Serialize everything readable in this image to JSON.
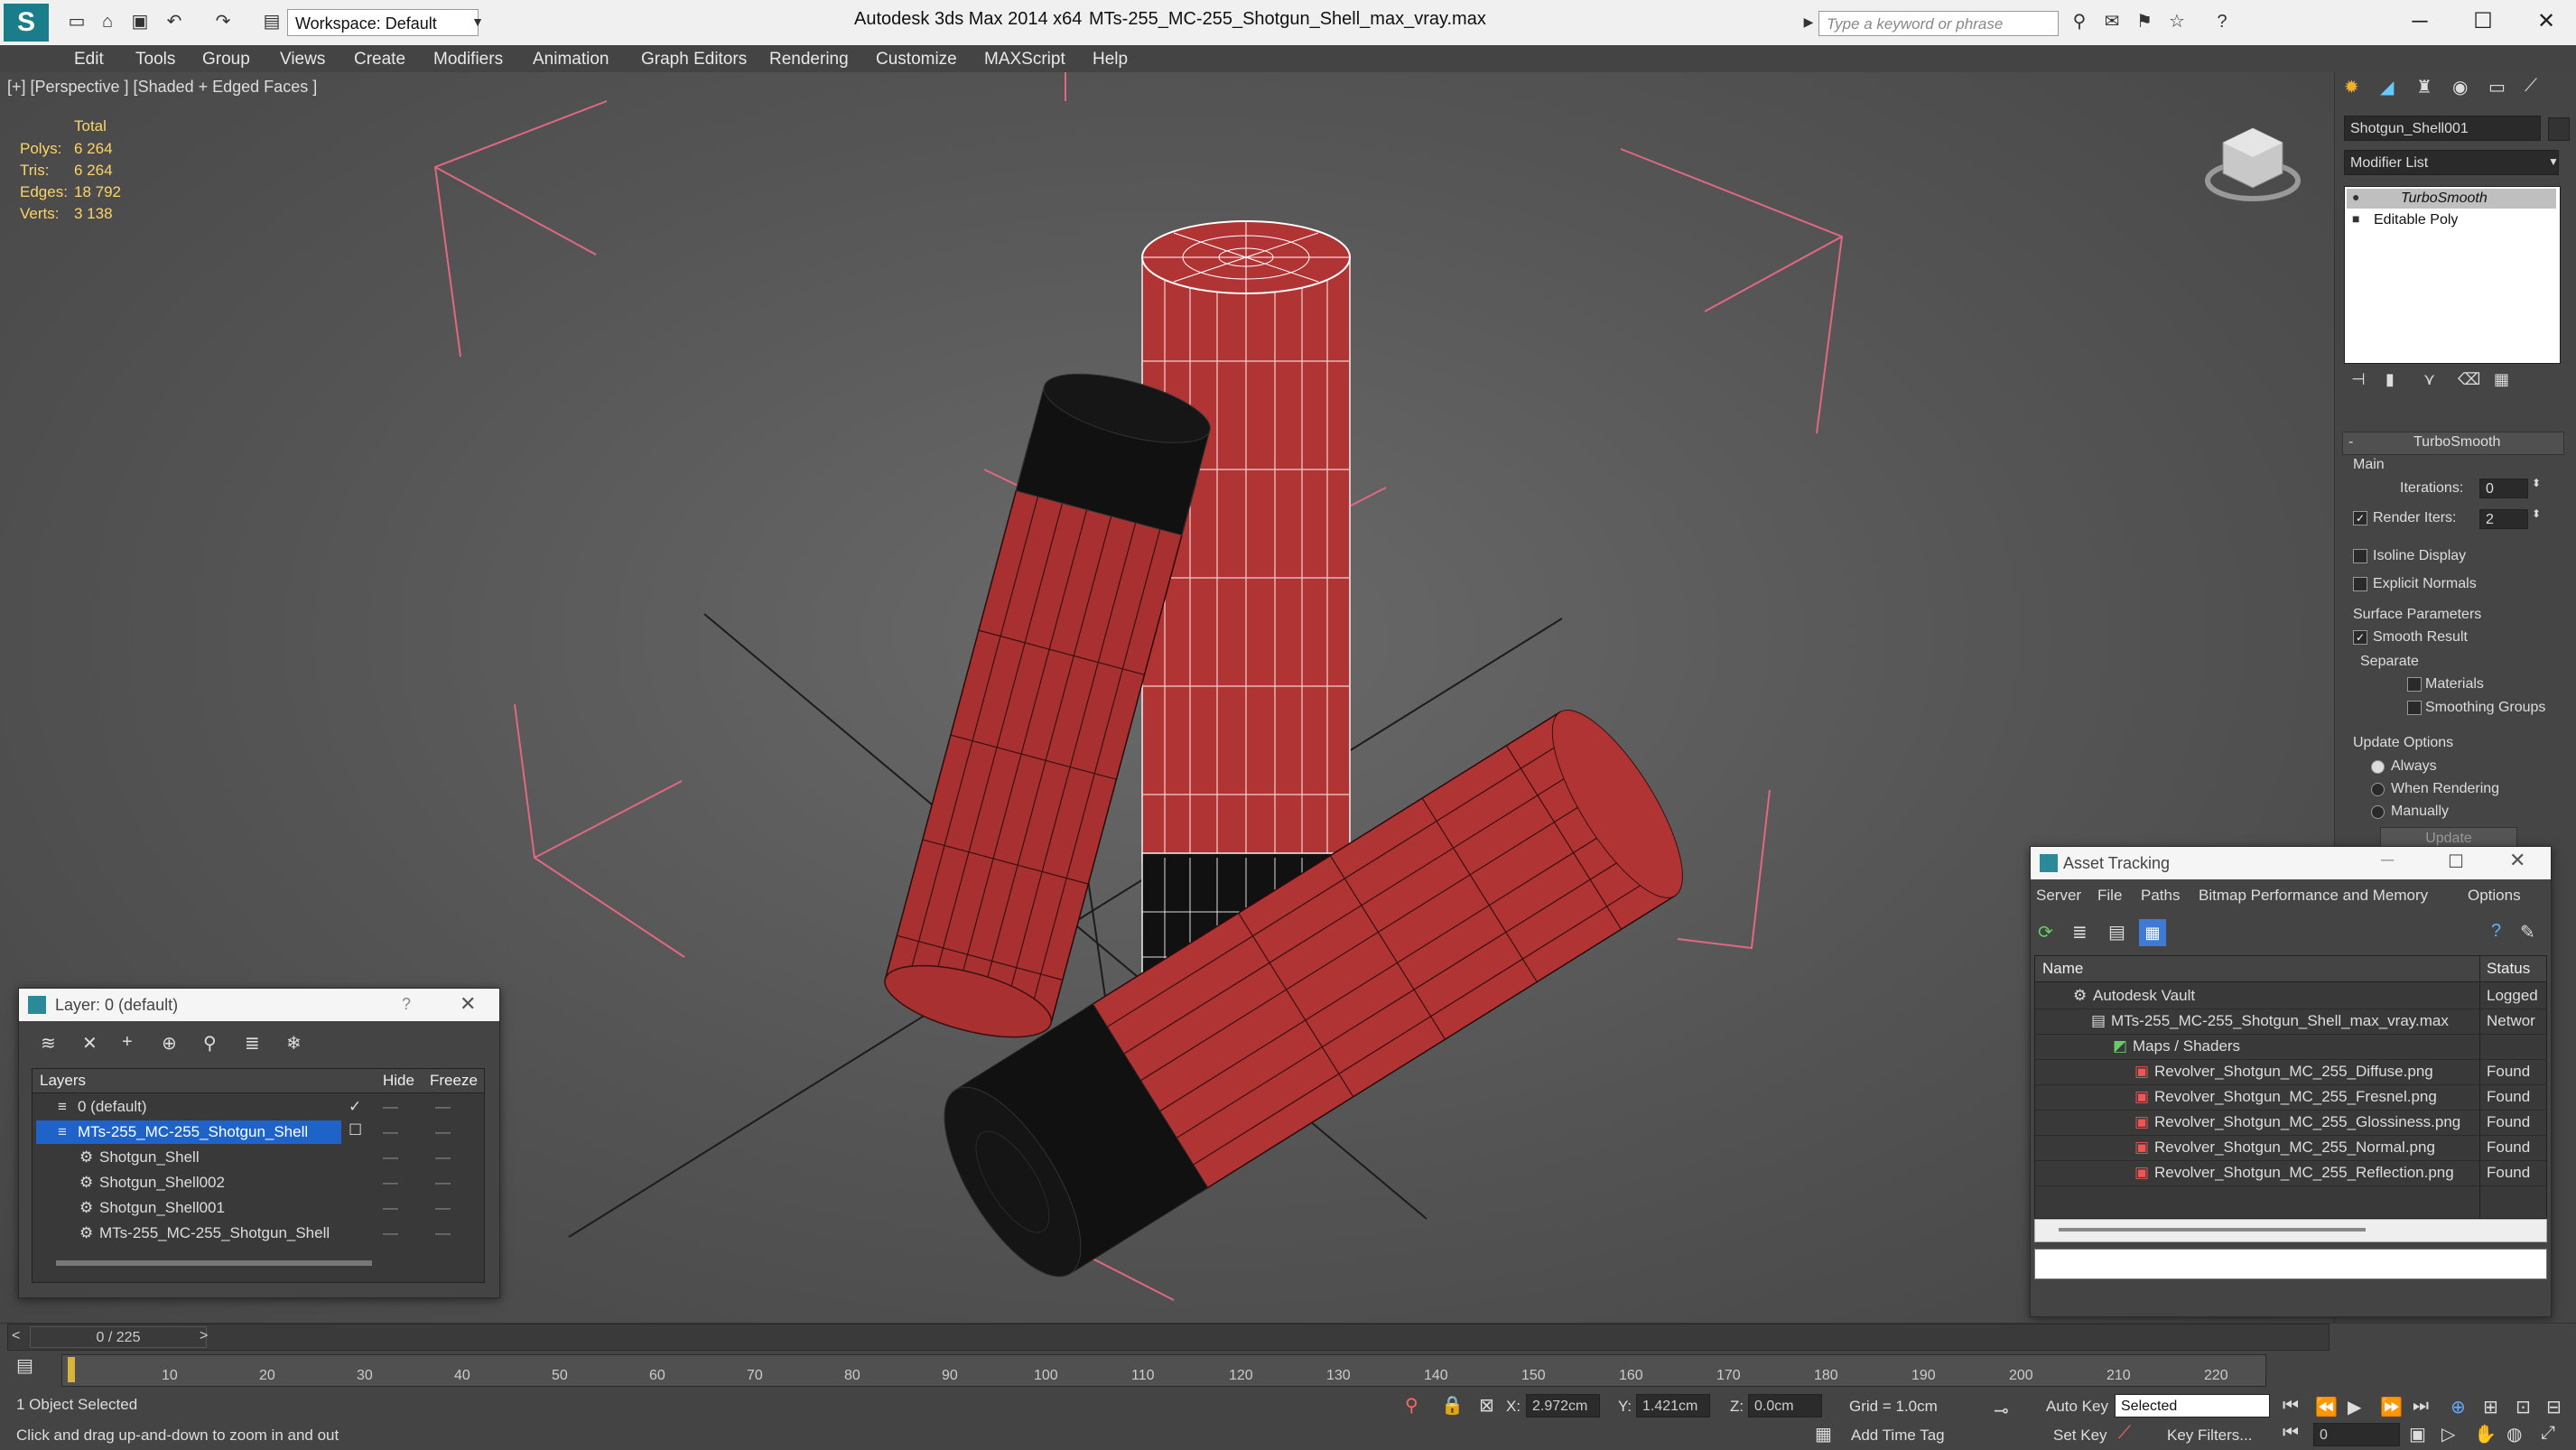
{
  "app": {
    "title": "Autodesk 3ds Max  2014 x64",
    "file": "MTs-255_MC-255_Shotgun_Shell_max_vray.max",
    "workspace": "Workspace: Default",
    "search_placeholder": "Type a keyword or phrase"
  },
  "menu": [
    "Edit",
    "Tools",
    "Group",
    "Views",
    "Create",
    "Modifiers",
    "Animation",
    "Graph Editors",
    "Rendering",
    "Customize",
    "MAXScript",
    "Help"
  ],
  "viewport": {
    "label": "[+] [Perspective ] [Shaded + Edged Faces ]",
    "stats": {
      "header": "Total",
      "rows": [
        {
          "label": "Polys:",
          "value": "6 264"
        },
        {
          "label": "Tris:",
          "value": "6 264"
        },
        {
          "label": "Edges:",
          "value": "18 792"
        },
        {
          "label": "Verts:",
          "value": "3 138"
        }
      ]
    }
  },
  "command_panel": {
    "object_name": "Shotgun_Shell001",
    "modifier_list": "Modifier List",
    "stack": [
      "TurboSmooth",
      "Editable Poly"
    ],
    "rollout_title": "TurboSmooth",
    "main_label": "Main",
    "iterations_label": "Iterations:",
    "iterations_value": "0",
    "render_iters_label": "Render Iters:",
    "render_iters_value": "2",
    "isoline": "Isoline Display",
    "explicit_normals": "Explicit Normals",
    "surface_params": "Surface Parameters",
    "smooth_result": "Smooth Result",
    "separate": "Separate",
    "materials": "Materials",
    "smoothing_groups": "Smoothing Groups",
    "update_options": "Update Options",
    "always": "Always",
    "when_rendering": "When Rendering",
    "manually": "Manually",
    "update": "Update"
  },
  "layer_window": {
    "title": "Layer: 0 (default)",
    "help": "?",
    "col_layers": "Layers",
    "col_hide": "Hide",
    "col_freeze": "Freeze",
    "rows": [
      "0 (default)",
      "MTs-255_MC-255_Shotgun_Shell",
      "Shotgun_Shell",
      "Shotgun_Shell002",
      "Shotgun_Shell001",
      "MTs-255_MC-255_Shotgun_Shell"
    ]
  },
  "asset_window": {
    "title": "Asset Tracking",
    "menu": [
      "Server",
      "File",
      "Paths",
      "Bitmap Performance and Memory",
      "Options"
    ],
    "col_name": "Name",
    "col_status": "Status",
    "rows": [
      {
        "name": "Autodesk Vault",
        "status": "Logged"
      },
      {
        "name": "MTs-255_MC-255_Shotgun_Shell_max_vray.max",
        "status": "Networ"
      },
      {
        "name": "Maps / Shaders",
        "status": ""
      },
      {
        "name": "Revolver_Shotgun_MC_255_Diffuse.png",
        "status": "Found"
      },
      {
        "name": "Revolver_Shotgun_MC_255_Fresnel.png",
        "status": "Found"
      },
      {
        "name": "Revolver_Shotgun_MC_255_Glossiness.png",
        "status": "Found"
      },
      {
        "name": "Revolver_Shotgun_MC_255_Normal.png",
        "status": "Found"
      },
      {
        "name": "Revolver_Shotgun_MC_255_Reflection.png",
        "status": "Found"
      }
    ]
  },
  "timeline": {
    "frame": "0 / 225",
    "ticks": [
      "10",
      "20",
      "30",
      "40",
      "50",
      "60",
      "70",
      "80",
      "90",
      "100",
      "110",
      "120",
      "130",
      "140",
      "150",
      "160",
      "170",
      "180",
      "190",
      "200",
      "210",
      "220"
    ]
  },
  "status": {
    "selected": "1 Object Selected",
    "hint": "Click and drag up-and-down to zoom in and out",
    "x_label": "X:",
    "x": "2.972cm",
    "y_label": "Y:",
    "y": "1.421cm",
    "z_label": "Z:",
    "z": "0.0cm",
    "grid": "Grid = 1.0cm",
    "add_time_tag": "Add Time Tag",
    "auto_key": "Auto Key",
    "set_key": "Set Key",
    "selected_dropdown": "Selected",
    "key_filters": "Key Filters...",
    "frame_field": "0"
  },
  "colors": {
    "shell_red": "#b03434",
    "selection_blue": "#1e63c8",
    "stats_yellow": "#ffd466"
  }
}
